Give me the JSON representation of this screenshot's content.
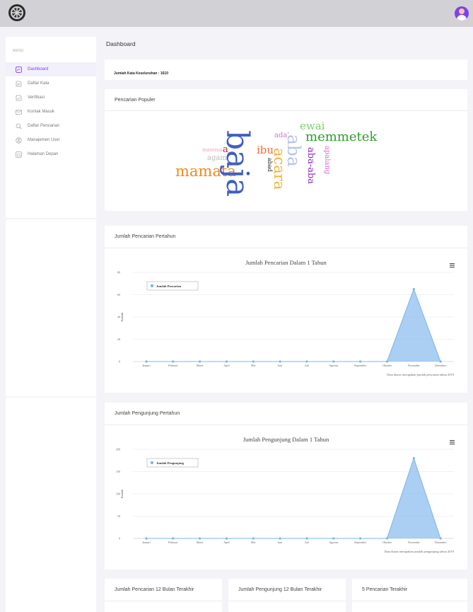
{
  "header": {
    "logo_icon": "university-seal-icon",
    "avatar_icon": "user-avatar-icon"
  },
  "sidebar": {
    "menu_label": "MENU",
    "items": [
      {
        "label": "Dashboard",
        "icon": "dashboard-icon",
        "active": true
      },
      {
        "label": "Daftar Kata",
        "icon": "book-icon"
      },
      {
        "label": "Verifikasi",
        "icon": "check-doc-icon"
      },
      {
        "label": "Kontak Masuk",
        "icon": "mail-icon"
      },
      {
        "label": "Daftar Pencarian",
        "icon": "search-icon"
      },
      {
        "label": "Manajemen User",
        "icon": "user-circle-icon"
      },
      {
        "label": "Halaman Depan",
        "icon": "home-icon"
      }
    ]
  },
  "main": {
    "title": "Dashboard",
    "total_words": "Jumlah Kata Keseluruhan : 1610",
    "popular_title": "Pencarian Populer",
    "word_cloud": [
      {
        "text": "baja",
        "color": "#3f5fc4"
      },
      {
        "text": "mamata",
        "color": "#f08a1c"
      },
      {
        "text": "memmetek",
        "color": "#2e9c2e"
      },
      {
        "text": "ewai",
        "color": "#7fd16a"
      },
      {
        "text": "aba",
        "color": "#b4c6ef"
      },
      {
        "text": "acara",
        "color": "#f3b33c"
      },
      {
        "text": "ibu",
        "color": "#f26d3a"
      },
      {
        "text": "aba-aba",
        "color": "#8a2fbf"
      },
      {
        "text": "apalang",
        "color": "#d96ad6"
      },
      {
        "text": "abad",
        "color": "#222222"
      },
      {
        "text": "agam",
        "color": "#bbbbbb"
      },
      {
        "text": "ada'",
        "color": "#cc77cc"
      },
      {
        "text": "a",
        "color": "#d8202a"
      },
      {
        "text": "mamma",
        "color": "#f4a3b5"
      }
    ],
    "yearly_search_title": "Jumlah Pencarian Pertahun",
    "yearly_visitor_title": "Jumlah Pengunjung Pertahun",
    "bottom_cards": [
      "Jumlah Pencarian 12 Bulan Terakhir",
      "Jumlah Pengunjung 12 Bulan Terakhir",
      "5 Pencarian Terakhir"
    ],
    "menu_icon": "hamburger-menu-icon"
  },
  "chart_data": [
    {
      "type": "area",
      "title": "Jumlah Pencarian Dalam 1 Tahun",
      "ylabel": "Jumlah",
      "xlabel": "",
      "categories": [
        "Januari",
        "Februari",
        "Maret",
        "April",
        "Mei",
        "Juni",
        "Juli",
        "Agustus",
        "September",
        "Oktober",
        "November",
        "Desember"
      ],
      "series": [
        {
          "name": "Jumlah Pencarian",
          "values": [
            0,
            0,
            0,
            0,
            0,
            0,
            0,
            0,
            0,
            0,
            65,
            0
          ]
        }
      ],
      "ylim": [
        0,
        80
      ],
      "yticks": [
        "0",
        "20",
        "40",
        "60",
        "80"
      ],
      "caption": "Data diatas merupakan jumlah pencarian tahun 2019",
      "color": "#7cb5ec",
      "grid": true,
      "legend_position": "top-left"
    },
    {
      "type": "area",
      "title": "Jumlah Pengunjung Dalam 1 Tahun",
      "ylabel": "Jumlah",
      "xlabel": "",
      "categories": [
        "Januari",
        "Februari",
        "Maret",
        "April",
        "Mei",
        "Juni",
        "Juli",
        "Agustus",
        "September",
        "Oktober",
        "November",
        "Desember"
      ],
      "series": [
        {
          "name": "Jumlah Pengunjung",
          "values": [
            0,
            0,
            0,
            0,
            0,
            0,
            0,
            0,
            0,
            0,
            180,
            0
          ]
        }
      ],
      "ylim": [
        0,
        200
      ],
      "yticks": [
        "0",
        "50",
        "100",
        "150",
        "200"
      ],
      "caption": "Data diatas merupakan jumlah pengunjung tahun 2019",
      "color": "#7cb5ec",
      "grid": true,
      "legend_position": "top-left"
    }
  ]
}
